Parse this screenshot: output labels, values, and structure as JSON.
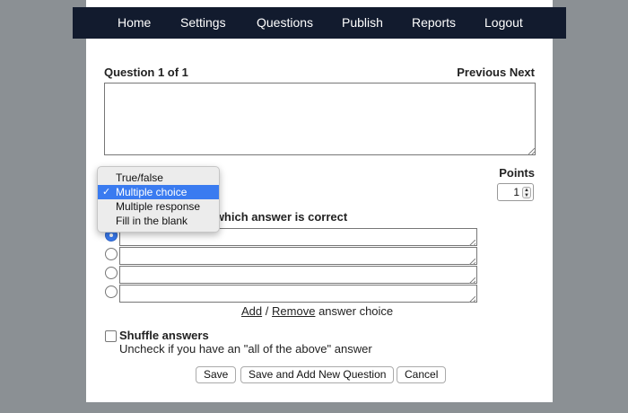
{
  "nav": {
    "items": [
      "Home",
      "Settings",
      "Questions",
      "Publish",
      "Reports",
      "Logout"
    ]
  },
  "question": {
    "header": "Question 1 of 1",
    "previous": "Previous",
    "next": "Next",
    "text_value": ""
  },
  "points": {
    "label": "Points",
    "value": "1"
  },
  "type_dropdown": {
    "options": [
      "True/false",
      "Multiple choice",
      "Multiple response",
      "Fill in the blank"
    ],
    "selected": "Multiple choice",
    "check_glyph": "✓"
  },
  "answers": {
    "instructions_visible": "hoices, and mark which answer is correct",
    "choices": [
      "",
      "",
      "",
      ""
    ],
    "correct_index": 0,
    "add_label": "Add",
    "separator": "/",
    "remove_label": "Remove",
    "suffix": "answer choice"
  },
  "shuffle": {
    "label": "Shuffle answers",
    "hint": "Uncheck if you have an \"all of the above\" answer",
    "checked": false
  },
  "buttons": {
    "save": "Save",
    "save_add": "Save and Add New Question",
    "cancel": "Cancel"
  },
  "colors": {
    "navbar": "#121b2e",
    "accent": "#3a7bf0",
    "background": "#8b9094"
  }
}
